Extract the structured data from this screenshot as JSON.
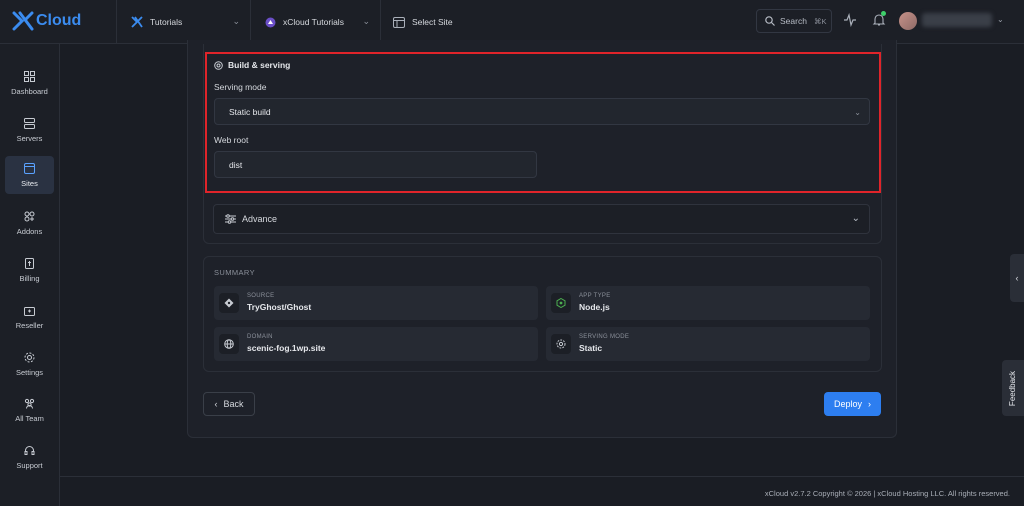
{
  "header": {
    "logo_text": "Cloud",
    "crumbs": [
      {
        "label": "Tutorials"
      },
      {
        "label": "xCloud Tutorials"
      },
      {
        "label": "Select Site"
      }
    ],
    "search_label": "Search",
    "search_shortcut": "⌘K"
  },
  "sidebar": {
    "items": [
      {
        "label": "Dashboard",
        "icon": "grid-icon"
      },
      {
        "label": "Servers",
        "icon": "server-icon"
      },
      {
        "label": "Sites",
        "icon": "browser-icon",
        "active": true
      },
      {
        "label": "Addons",
        "icon": "addons-icon"
      },
      {
        "label": "Billing",
        "icon": "billing-icon"
      },
      {
        "label": "Reseller",
        "icon": "reseller-icon"
      },
      {
        "label": "Settings",
        "icon": "gear-icon"
      },
      {
        "label": "All Team",
        "icon": "team-icon"
      },
      {
        "label": "Support",
        "icon": "headset-icon"
      }
    ]
  },
  "build": {
    "title": "Build & serving",
    "serving_mode_label": "Serving mode",
    "serving_mode_value": "Static build",
    "web_root_label": "Web root",
    "web_root_value": "dist",
    "advance_label": "Advance"
  },
  "summary": {
    "title": "SUMMARY",
    "items": [
      {
        "label": "SOURCE",
        "value": "TryGhost/Ghost",
        "icon": "git-icon"
      },
      {
        "label": "APP TYPE",
        "value": "Node.js",
        "icon": "nodejs-icon"
      },
      {
        "label": "DOMAIN",
        "value": "scenic-fog.1wp.site",
        "icon": "globe-icon"
      },
      {
        "label": "SERVING MODE",
        "value": "Static",
        "icon": "settings-icon"
      }
    ]
  },
  "actions": {
    "back_label": "Back",
    "deploy_label": "Deploy"
  },
  "side_tabs": {
    "feedback_label": "Feedback"
  },
  "footer": {
    "copyright": "xCloud v2.7.2 Copyright © 2026 | xCloud Hosting LLC. All rights reserved."
  },
  "colors": {
    "accent": "#2d7ef0",
    "highlight": "#e0242a",
    "background": "#1a1d24",
    "notification_dot": "#3ecf6a"
  }
}
